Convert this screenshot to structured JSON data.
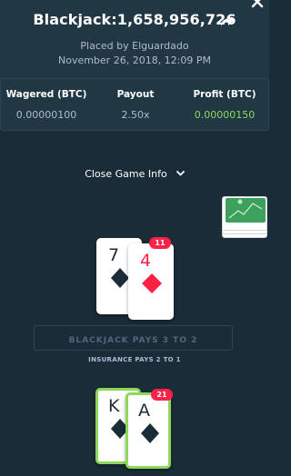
{
  "header": {
    "title": "Blackjack:1,658,956,726",
    "placed_by": "Placed by Elguardado",
    "date": "November 26, 2018, 12:09 PM"
  },
  "stats": {
    "wagered_label": "Wagered (BTC)",
    "wagered_value": "0.00000100",
    "payout_label": "Payout",
    "payout_value": "2.50x",
    "profit_label": "Profit (BTC)",
    "profit_value": "0.00000150"
  },
  "toggle": {
    "label": "Close Game Info"
  },
  "dealer": {
    "score": "11",
    "cards": [
      {
        "rank": "7",
        "suit": "spade"
      },
      {
        "rank": "4",
        "suit": "diamond"
      }
    ]
  },
  "table_text": {
    "blackjack_pays": "BLACKJACK PAYS 3 TO 2",
    "insurance_pays": "INSURANCE PAYS 2 TO 1"
  },
  "player": {
    "score": "21",
    "cards": [
      {
        "rank": "K",
        "suit": "spade"
      },
      {
        "rank": "A",
        "suit": "spade"
      }
    ]
  },
  "colors": {
    "background": "#1a2c38",
    "panel": "#213743",
    "win_green": "#8cd95a",
    "badge_red": "#fe2247"
  },
  "icons": [
    "share-icon",
    "close-icon",
    "chevron-down-icon",
    "spade-icon",
    "diamond-icon"
  ]
}
